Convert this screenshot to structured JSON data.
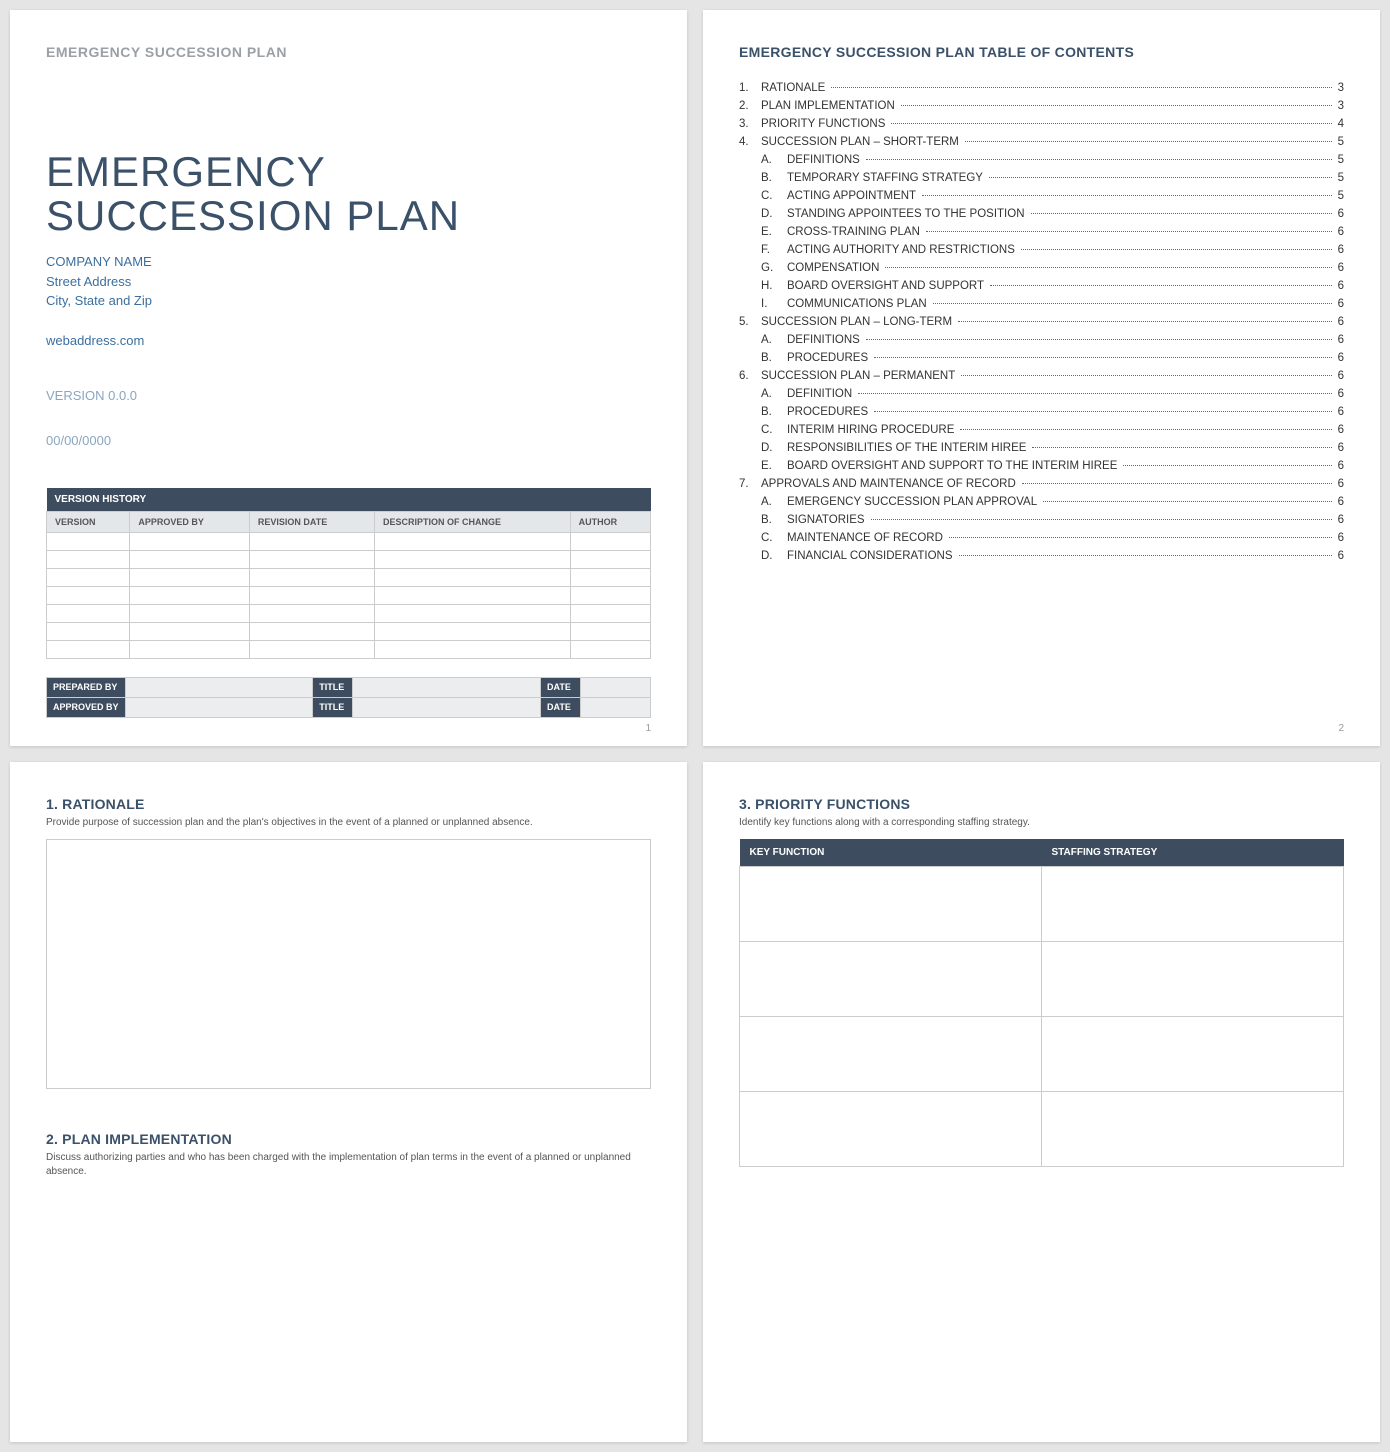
{
  "page1": {
    "header": "EMERGENCY SUCCESSION PLAN",
    "title_line1": "EMERGENCY",
    "title_line2": "SUCCESSION PLAN",
    "company": "COMPANY NAME",
    "street": "Street Address",
    "citystate": "City, State and Zip",
    "web": "webaddress.com",
    "version": "VERSION 0.0.0",
    "date": "00/00/0000",
    "vh_title": "VERSION HISTORY",
    "vh_cols": [
      "VERSION",
      "APPROVED BY",
      "REVISION DATE",
      "DESCRIPTION OF CHANGE",
      "AUTHOR"
    ],
    "sig_labels": {
      "prepared": "PREPARED BY",
      "approved": "APPROVED BY",
      "title": "TITLE",
      "date": "DATE"
    },
    "pagenum": "1"
  },
  "page2": {
    "title": "EMERGENCY SUCCESSION PLAN TABLE OF CONTENTS",
    "toc": [
      {
        "n": "1.",
        "t": "RATIONALE",
        "p": "3"
      },
      {
        "n": "2.",
        "t": "PLAN IMPLEMENTATION",
        "p": "3"
      },
      {
        "n": "3.",
        "t": "PRIORITY FUNCTIONS",
        "p": "4"
      },
      {
        "n": "4.",
        "t": "SUCCESSION PLAN – SHORT-TERM",
        "p": "5"
      },
      {
        "n": "A.",
        "t": "DEFINITIONS",
        "p": "5",
        "sub": true
      },
      {
        "n": "B.",
        "t": "TEMPORARY STAFFING STRATEGY",
        "p": "5",
        "sub": true
      },
      {
        "n": "C.",
        "t": "ACTING APPOINTMENT",
        "p": "5",
        "sub": true
      },
      {
        "n": "D.",
        "t": "STANDING APPOINTEES TO THE POSITION",
        "p": "6",
        "sub": true
      },
      {
        "n": "E.",
        "t": "CROSS-TRAINING PLAN",
        "p": "6",
        "sub": true
      },
      {
        "n": "F.",
        "t": "ACTING AUTHORITY AND RESTRICTIONS",
        "p": "6",
        "sub": true
      },
      {
        "n": "G.",
        "t": "COMPENSATION",
        "p": "6",
        "sub": true
      },
      {
        "n": "H.",
        "t": "BOARD OVERSIGHT AND SUPPORT",
        "p": "6",
        "sub": true
      },
      {
        "n": "I.",
        "t": "COMMUNICATIONS PLAN",
        "p": "6",
        "sub": true
      },
      {
        "n": "5.",
        "t": "SUCCESSION PLAN – LONG-TERM",
        "p": "6"
      },
      {
        "n": "A.",
        "t": "DEFINITIONS",
        "p": "6",
        "sub": true
      },
      {
        "n": "B.",
        "t": "PROCEDURES",
        "p": "6",
        "sub": true
      },
      {
        "n": "6.",
        "t": "SUCCESSION PLAN – PERMANENT",
        "p": "6"
      },
      {
        "n": "A.",
        "t": "DEFINITION",
        "p": "6",
        "sub": true
      },
      {
        "n": "B.",
        "t": "PROCEDURES",
        "p": "6",
        "sub": true
      },
      {
        "n": "C.",
        "t": "INTERIM HIRING PROCEDURE",
        "p": "6",
        "sub": true
      },
      {
        "n": "D.",
        "t": "RESPONSIBILITIES OF THE INTERIM HIREE",
        "p": "6",
        "sub": true
      },
      {
        "n": "E.",
        "t": "BOARD OVERSIGHT AND SUPPORT TO THE INTERIM HIREE",
        "p": "6",
        "sub": true
      },
      {
        "n": "7.",
        "t": "APPROVALS AND MAINTENANCE OF RECORD",
        "p": "6"
      },
      {
        "n": "A.",
        "t": "EMERGENCY SUCCESSION PLAN APPROVAL",
        "p": "6",
        "sub": true
      },
      {
        "n": "B.",
        "t": "SIGNATORIES",
        "p": "6",
        "sub": true
      },
      {
        "n": "C.",
        "t": "MAINTENANCE OF RECORD",
        "p": "6",
        "sub": true
      },
      {
        "n": "D.",
        "t": "FINANCIAL CONSIDERATIONS",
        "p": "6",
        "sub": true
      }
    ],
    "pagenum": "2"
  },
  "page3": {
    "sec1_h": "1.  RATIONALE",
    "sec1_d": "Provide purpose of succession plan and the plan's objectives in the event of a planned or unplanned absence.",
    "sec2_h": "2.  PLAN IMPLEMENTATION",
    "sec2_d": "Discuss authorizing parties and who has been charged with the implementation of plan terms in the event of a planned or unplanned absence."
  },
  "page4": {
    "sec_h": "3.  PRIORITY FUNCTIONS",
    "sec_d": "Identify key functions along with a corresponding staffing strategy.",
    "cols": [
      "KEY FUNCTION",
      "STAFFING STRATEGY"
    ]
  }
}
